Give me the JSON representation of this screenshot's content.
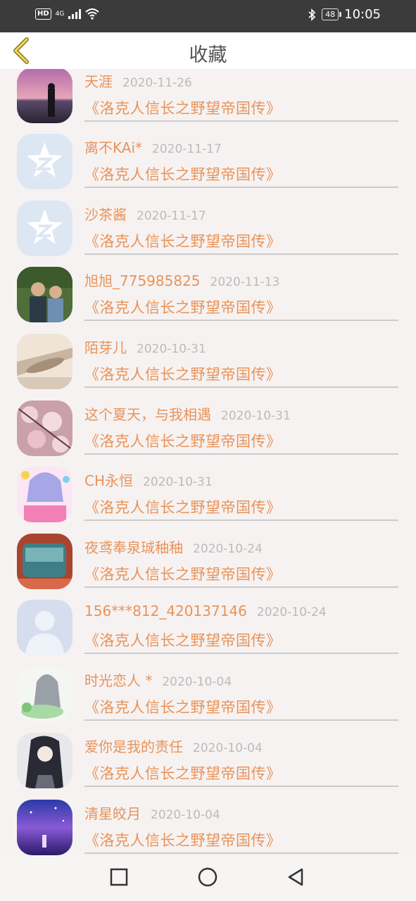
{
  "status": {
    "network": "4G",
    "hd": "HD",
    "battery": "48",
    "time": "10:05"
  },
  "header": {
    "title": "收藏"
  },
  "items": [
    {
      "name": "天涯",
      "date": "2020-11-26",
      "book": "《洛克人信长之野望帝国传》"
    },
    {
      "name": "离不KAi*",
      "date": "2020-11-17",
      "book": "《洛克人信长之野望帝国传》"
    },
    {
      "name": "沙茶酱",
      "date": "2020-11-17",
      "book": "《洛克人信长之野望帝国传》"
    },
    {
      "name": "旭旭_775985825",
      "date": "2020-11-13",
      "book": "《洛克人信长之野望帝国传》"
    },
    {
      "name": "陌芽儿",
      "date": "2020-10-31",
      "book": "《洛克人信长之野望帝国传》"
    },
    {
      "name": "这个夏天，与我相遇",
      "date": "2020-10-31",
      "book": "《洛克人信长之野望帝国传》"
    },
    {
      "name": "CH永恒",
      "date": "2020-10-31",
      "book": "《洛克人信长之野望帝国传》"
    },
    {
      "name": "夜鸢奉泉珹秞秞",
      "date": "2020-10-24",
      "book": "《洛克人信长之野望帝国传》"
    },
    {
      "name": "156***812_420137146",
      "date": "2020-10-24",
      "book": "《洛克人信长之野望帝国传》"
    },
    {
      "name": "时光恋人 *",
      "date": "2020-10-04",
      "book": "《洛克人信长之野望帝国传》"
    },
    {
      "name": "爱你是我的责任",
      "date": "2020-10-04",
      "book": "《洛克人信长之野望帝国传》"
    },
    {
      "name": "清星皎月",
      "date": "2020-10-04",
      "book": "《洛克人信长之野望帝国传》"
    }
  ],
  "colors": {
    "accent": "#e99358",
    "date": "#bbbbbb",
    "statusbar": "#3b3b3b"
  },
  "icons": {
    "back": "chevron-left-icon",
    "nav": [
      "square-icon",
      "circle-icon",
      "triangle-back-icon"
    ]
  }
}
